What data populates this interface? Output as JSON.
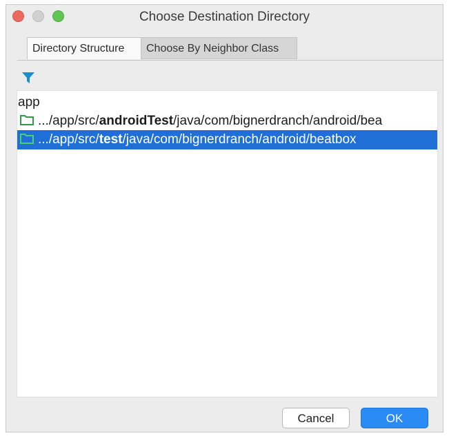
{
  "window": {
    "title": "Choose Destination Directory"
  },
  "tabs": [
    {
      "label": "Directory Structure",
      "selected": true
    },
    {
      "label": "Choose By Neighbor Class",
      "selected": false
    }
  ],
  "toolbar": {
    "filter_icon": "filter-icon"
  },
  "tree": {
    "root_label": "app",
    "items": [
      {
        "prefix": ".../app/src/",
        "highlight": "androidTest",
        "suffix": "/java/com/bignerdranch/android/bea",
        "selected": false,
        "icon": "folder-icon"
      },
      {
        "prefix": ".../app/src/",
        "highlight": "test",
        "suffix": "/java/com/bignerdranch/android/beatbox",
        "selected": true,
        "icon": "folder-icon"
      }
    ]
  },
  "buttons": {
    "cancel_label": "Cancel",
    "ok_label": "OK"
  },
  "colors": {
    "selection": "#1f6fd7",
    "ok_button": "#2a8bf4",
    "folder": "#2f9a4d",
    "filter": "#1b8fc9"
  }
}
